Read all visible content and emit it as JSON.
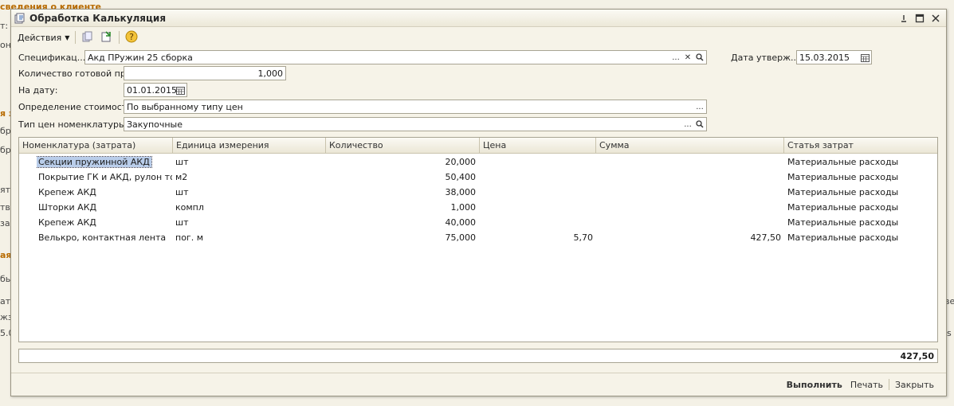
{
  "background": {
    "left_fragments": [
      "сведения о клиенте",
      "т:",
      "он",
      "я з",
      "бр",
      "бр",
      "яте",
      "тв",
      "за",
      "ая",
      "бь",
      "ат",
      "жз",
      "5.0"
    ],
    "right_fragments": [
      "ве",
      "s"
    ]
  },
  "window": {
    "title": "Обработка  Калькуляция",
    "icons": {
      "app": "form-icon",
      "pin": "pin-icon",
      "maximize": "maximize-icon",
      "close": "close-icon"
    }
  },
  "toolbar": {
    "actions_label": "Действия",
    "buttons": [
      "copy-document-icon",
      "export-icon",
      "help-icon"
    ]
  },
  "form": {
    "specification_label": "Спецификац...",
    "specification_value": "Акд ПРужин 25 сборка",
    "approval_date_label": "Дата утверж...",
    "approval_date_value": "15.03.2015",
    "quantity_label": "Количество готовой пр...",
    "quantity_value": "1,000",
    "on_date_label": "На дату:",
    "on_date_value": "01.01.2015",
    "cost_definition_label": "Определение стоимости:",
    "cost_definition_value": "По выбранному типу цен",
    "price_type_label": "Тип цен номенклатуры:",
    "price_type_value": "Закупочные"
  },
  "table": {
    "columns": [
      "Номенклатура (затрата)",
      "Единица измерения",
      "Количество",
      "Цена",
      "Сумма",
      "Статья затрат"
    ],
    "rows": [
      {
        "name": "Секции пружинной АКД",
        "unit": "шт",
        "qty": "20,000",
        "price": "",
        "sum": "",
        "article": "Материальные расходы"
      },
      {
        "name": "Покрытие ГК и АКД, рулон то...",
        "unit": "м2",
        "qty": "50,400",
        "price": "",
        "sum": "",
        "article": "Материальные расходы"
      },
      {
        "name": "Крепеж  АКД",
        "unit": "шт",
        "qty": "38,000",
        "price": "",
        "sum": "",
        "article": "Материальные расходы"
      },
      {
        "name": "Шторки АКД",
        "unit": "компл",
        "qty": "1,000",
        "price": "",
        "sum": "",
        "article": "Материальные расходы"
      },
      {
        "name": "Крепеж  АКД",
        "unit": "шт",
        "qty": "40,000",
        "price": "",
        "sum": "",
        "article": "Материальные расходы"
      },
      {
        "name": "Велькро, контактная лента",
        "unit": "пог. м",
        "qty": "75,000",
        "price": "5,70",
        "sum": "427,50",
        "article": "Материальные расходы"
      }
    ]
  },
  "total": "427,50",
  "footer": {
    "execute": "Выполнить",
    "print": "Печать",
    "close": "Закрыть"
  }
}
